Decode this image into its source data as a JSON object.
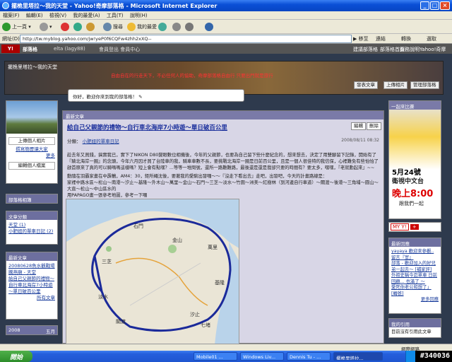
{
  "window": {
    "title": "擺桅里塔拉～我的天堂 - Yahoo!奇摩部落格 - Microsoft Internet Explorer"
  },
  "menu": [
    "檔案(F)",
    "編輯(E)",
    "檢視(V)",
    "我的最愛(A)",
    "工具(T)",
    "說明(H)"
  ],
  "toolbar": {
    "back": "上一頁",
    "search": "搜尋",
    "favorites": "我的最愛"
  },
  "address": {
    "label": "網址(D)",
    "url": "http://tw.myblog.yahoo.com/jw!yeP0f6CQFw4zhh2xXQ--",
    "go": "移至",
    "links": "連結",
    "convert": "轉換",
    "select": "選取"
  },
  "ybar": {
    "blog": "部落格",
    "user": "elta (lagy88)",
    "signout": "登出",
    "member_center": "會員登出 會員中心",
    "r1": "建議部落格",
    "r2": "部落格首頁",
    "r3": "服務說明",
    "r4": "Yahoo!奇摩"
  },
  "header": {
    "title": "擺桅里塔拉～我的天堂",
    "marquee": "自由自在的行走天下，不必任何人的協助，奇摩部落格自由行 只要出門就是旅行",
    "btn_post": "發表文章",
    "btn_upload": "上傳相片",
    "btn_manage": "管理部落格"
  },
  "greeting": "你好，歡迎你來到我的部落格！",
  "left": {
    "btn_upload_photo": "上傳個人相片",
    "link_intro": "撰寫簡歷讓大家",
    "link_more": "更多",
    "btn_edit": "編輯個人檔案",
    "p1": "部落格相簿",
    "p2": "文章分類",
    "cats": [
      "天堂 (1)",
      "小肥妞的單車日記 (2)"
    ],
    "p3": "最新文章",
    "recent": [
      "20080628魚水觀戰場",
      "騰燕廟 - 天堂",
      "給自己父親節的禮物～自行車北海岸7小時遊～單日破百公里"
    ],
    "all_posts": "所有文章",
    "cal": "2008",
    "cal_arrow": "五月"
  },
  "post": {
    "section": "最新文章",
    "title": "給自己父親節的禮物～自行車北海岸7小時遊～單日破百公里",
    "edit": "編輯",
    "delete": "刪除",
    "category_label": "分類：",
    "category": "小肥妞的單車日記",
    "date": "2008/08/11 08:32",
    "para1": "趁去年又買錢，搞實我已，實下了NIKON D80變眼數位相機後，今年的父親節，也要為自己留下些什麼紀念的，想來想去，決定了用雙腳留下記錄，開始有了『騎北海岸一圈』的念頭，今年六月因才買了台陸車的我，騎車車數不長，要挑戰北海岸一圈是日前百公里，且是一個人很佳特的我信保，心裡難免有些怕怕了啟首原來了真的可以騎嗎嗎這樣嗎？短上會有點嘿？...等等一堆問號，還所一路難難路，最後還是還是我卻只要的時間有？要太多，嘿嘿，『老就動起來』~~",
    "para2": "動隨在羽霸家畫在中霹鶺，AM4：30，鉅所蠅沈後，要著我的愛駒出發囉～～『沒走下看出去』走吧，出發吧，今天的計畫路線是：",
    "para3": "家裡中路水區～松山～南港～汐止～基隆～外木山～萬里～金山～石門～三芝～淡水～竹圍～洲美～紅樹林（到河邊自行車道）～關渡～後港～三角埔～圓山～大直～松山～中山區水的",
    "para4": "用PAPAGO畫一張參考地圖，參考一下囉"
  },
  "right": {
    "r1": "一起來比賽",
    "ad_date": "5月24號",
    "ad_channel": "衛視中文台",
    "ad_time": "晚上8:00",
    "ad_sub": "跟我們一起",
    "yahoo_badge": "MY Y!",
    "r2": "最新回應",
    "comments": [
      "yayaya 歡迎來參觀.. 留言『室』",
      "部落 - 歡迎加入的好兄弟一起去～ [補家評]",
      "外祖史稱今忍單車 日前回顧... 也滿了 ～",
      "愛死你老公和想了」 [轉爸]"
    ],
    "more": "更多回應",
    "r3": "我的引用",
    "r3_body": "目前沒有引用此文章"
  },
  "map_labels": [
    "七堵",
    "基隆",
    "汐止",
    "淡水",
    "金山",
    "萬里",
    "石門",
    "三芝",
    "關渡"
  ],
  "status": {
    "zone": "網際網路"
  },
  "taskbar": {
    "start": "開始",
    "tasks": [
      "Mobile01 ...",
      "Windows Liv...",
      "Dennis Tu - ...",
      "擺桅里塔拉..."
    ],
    "clock": "#340036"
  },
  "colors": {
    "header_bg": "#6b4b2c",
    "panel_head": "#6d6f9f",
    "link": "#1a3d9c"
  }
}
